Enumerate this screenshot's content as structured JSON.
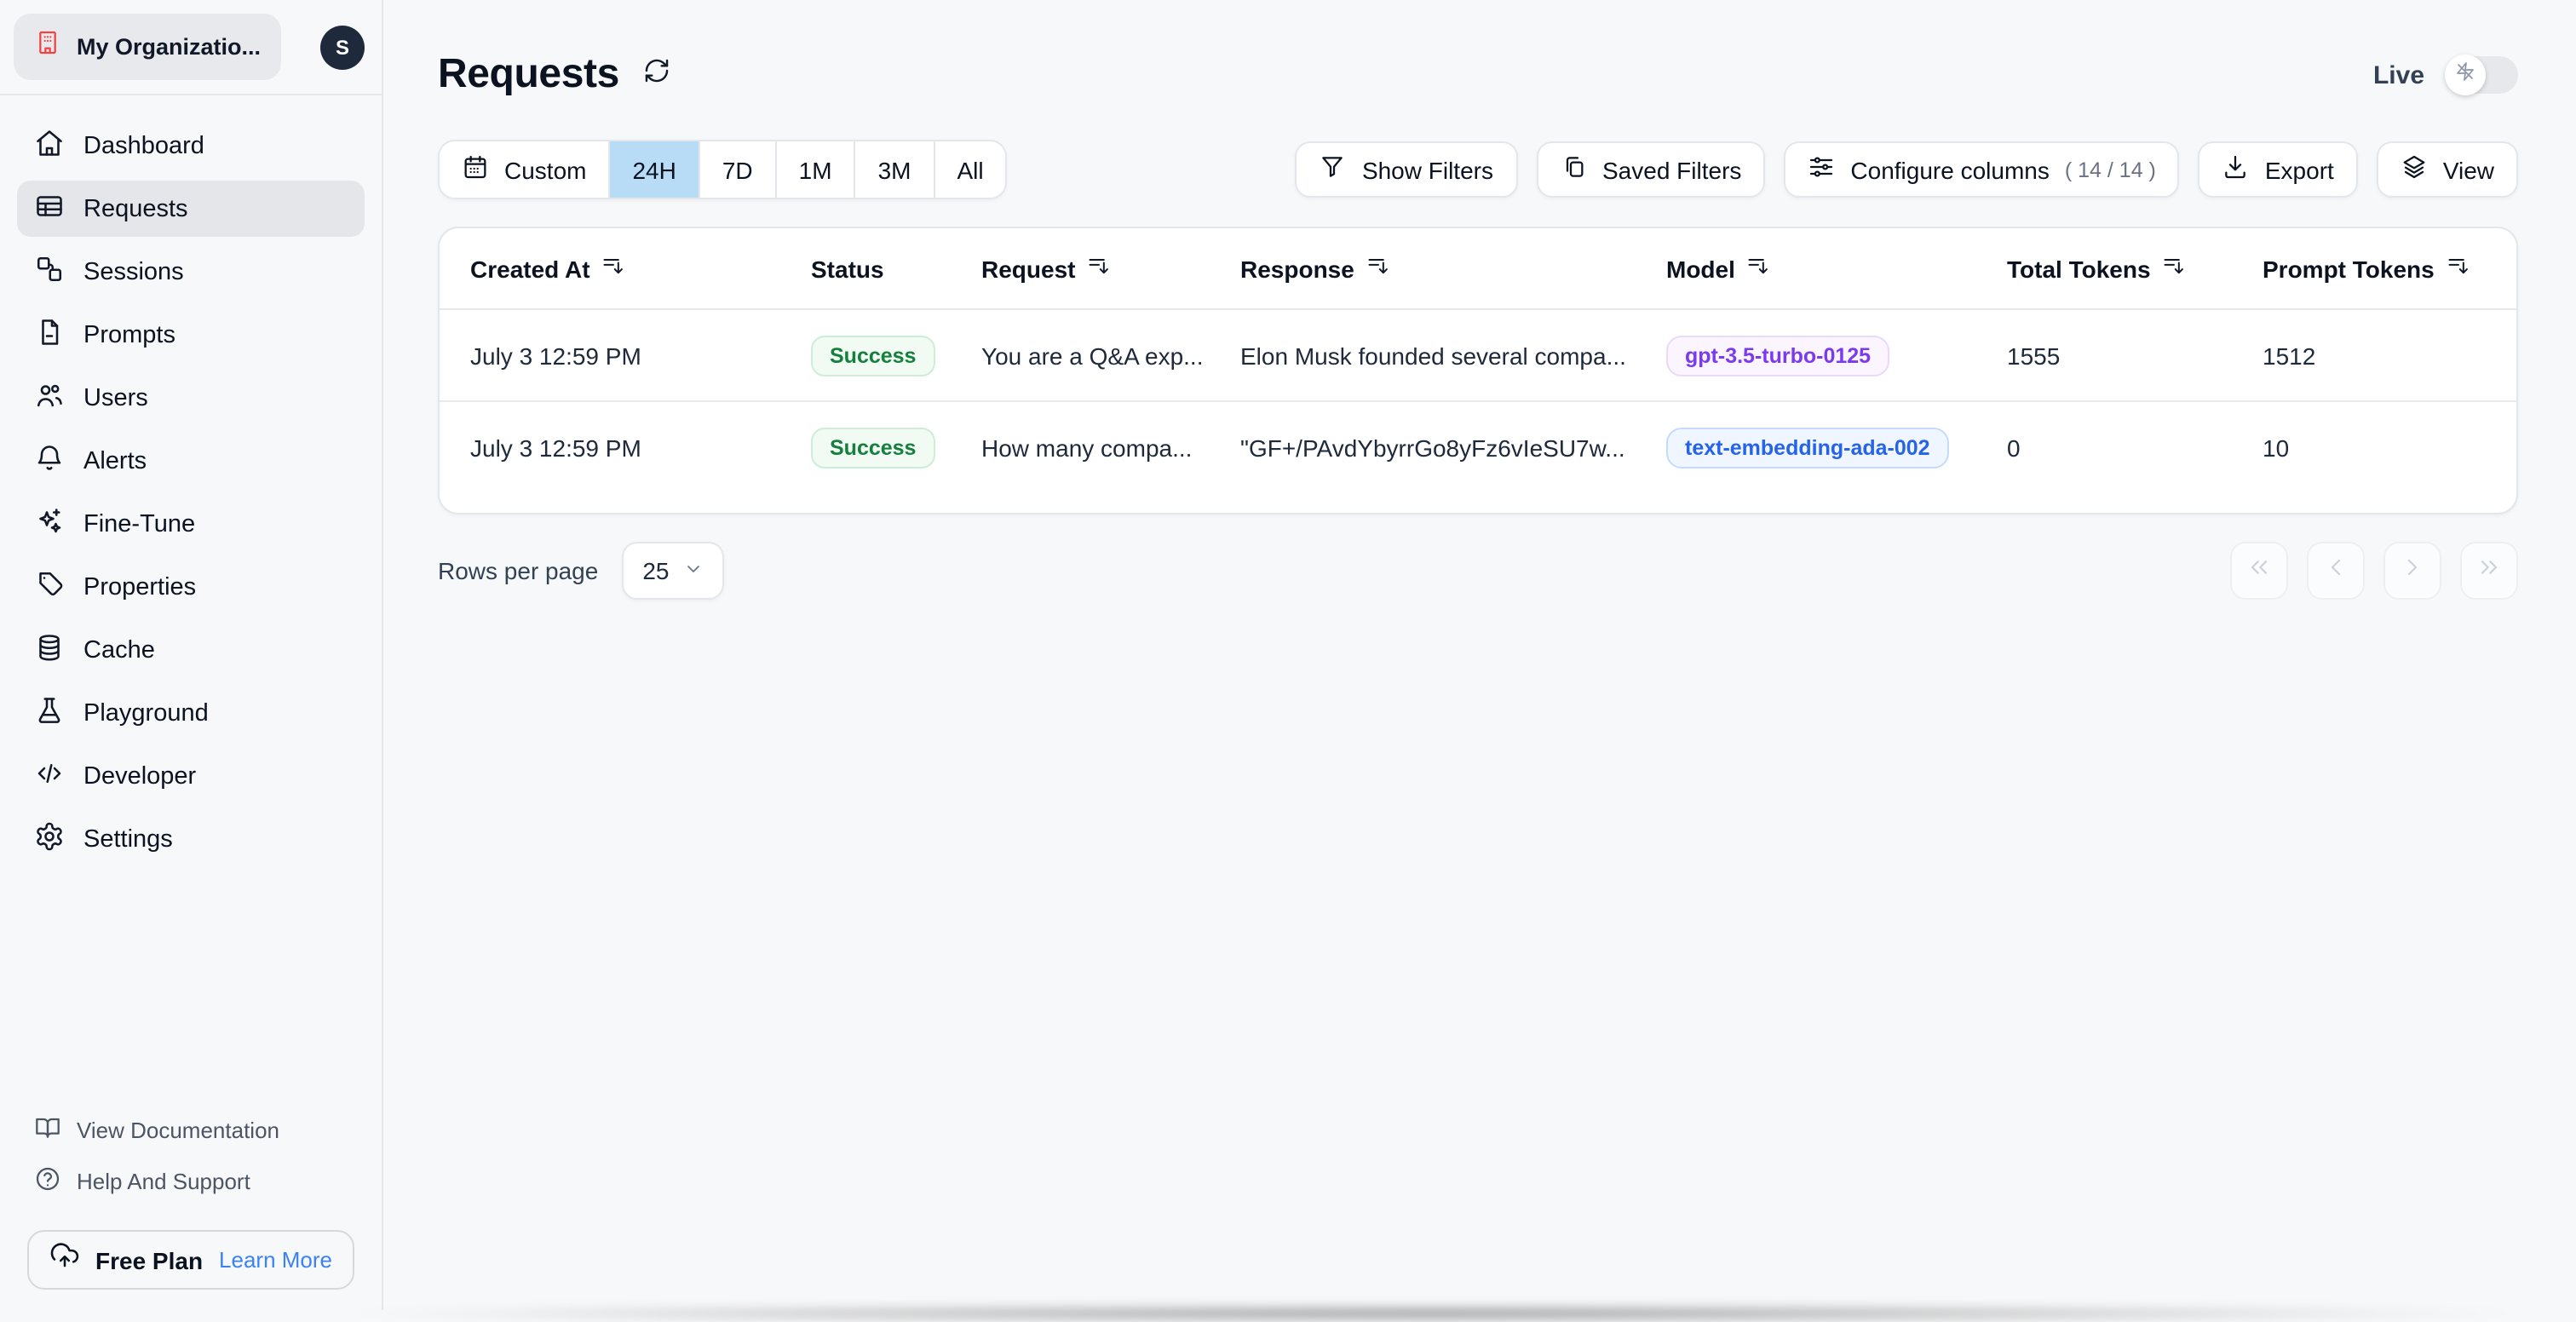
{
  "sidebar": {
    "org": {
      "name": "My Organizatio...",
      "avatar_initial": "S"
    },
    "nav": [
      {
        "label": "Dashboard",
        "icon": "home-icon",
        "active": false
      },
      {
        "label": "Requests",
        "icon": "table-icon",
        "active": true
      },
      {
        "label": "Sessions",
        "icon": "sessions-icon",
        "active": false
      },
      {
        "label": "Prompts",
        "icon": "document-icon",
        "active": false
      },
      {
        "label": "Users",
        "icon": "users-icon",
        "active": false
      },
      {
        "label": "Alerts",
        "icon": "bell-icon",
        "active": false
      },
      {
        "label": "Fine-Tune",
        "icon": "sparkles-icon",
        "active": false
      },
      {
        "label": "Properties",
        "icon": "tag-icon",
        "active": false
      },
      {
        "label": "Cache",
        "icon": "database-icon",
        "active": false
      },
      {
        "label": "Playground",
        "icon": "flask-icon",
        "active": false
      },
      {
        "label": "Developer",
        "icon": "code-icon",
        "active": false
      },
      {
        "label": "Settings",
        "icon": "gear-icon",
        "active": false
      }
    ],
    "footer_links": [
      {
        "label": "View Documentation",
        "icon": "book-open-icon"
      },
      {
        "label": "Help And Support",
        "icon": "help-circle-icon"
      }
    ],
    "plan": {
      "label": "Free Plan",
      "cta": "Learn More",
      "icon": "cloud-upload-icon"
    }
  },
  "header": {
    "title": "Requests",
    "live_label": "Live",
    "live_on": false
  },
  "toolbar": {
    "time_ranges": [
      {
        "label": "Custom",
        "icon": "calendar-icon",
        "selected": false
      },
      {
        "label": "24H",
        "selected": true
      },
      {
        "label": "7D",
        "selected": false
      },
      {
        "label": "1M",
        "selected": false
      },
      {
        "label": "3M",
        "selected": false
      },
      {
        "label": "All",
        "selected": false
      }
    ],
    "buttons": [
      {
        "label": "Show Filters",
        "icon": "funnel-icon"
      },
      {
        "label": "Saved Filters",
        "icon": "copy-icon"
      },
      {
        "label": "Configure columns",
        "suffix": "( 14 / 14 )",
        "icon": "sliders-icon"
      },
      {
        "label": "Export",
        "icon": "download-icon"
      },
      {
        "label": "View",
        "icon": "layers-icon"
      }
    ]
  },
  "table": {
    "columns": [
      {
        "label": "Created At",
        "sortable": true
      },
      {
        "label": "Status",
        "sortable": false
      },
      {
        "label": "Request",
        "sortable": true
      },
      {
        "label": "Response",
        "sortable": true
      },
      {
        "label": "Model",
        "sortable": true
      },
      {
        "label": "Total Tokens",
        "sortable": true
      },
      {
        "label": "Prompt Tokens",
        "sortable": true
      }
    ],
    "rows": [
      {
        "created_at": "July 3 12:59 PM",
        "status": "Success",
        "request": "You are a Q&A exp...",
        "response": "Elon Musk founded several compa...",
        "model": "gpt-3.5-turbo-0125",
        "model_color": "purple",
        "total_tokens": "1555",
        "prompt_tokens": "1512"
      },
      {
        "created_at": "July 3 12:59 PM",
        "status": "Success",
        "request": "How many compa...",
        "response": "\"GF+/PAvdYbyrrGo8yFz6vIeSU7w...",
        "model": "text-embedding-ada-002",
        "model_color": "blue",
        "total_tokens": "0",
        "prompt_tokens": "10"
      }
    ]
  },
  "pagination": {
    "rows_per_page_label": "Rows per page",
    "rows_per_page_value": "25"
  },
  "colors": {
    "page_bg": "#f7f8f9",
    "border": "#e5e7eb",
    "selected_range_bg": "#b9dcf6",
    "success_text": "#15803d",
    "success_bg": "#f1faf3",
    "model_purple": "#7c3aed",
    "model_blue": "#2563eb",
    "link_blue": "#3b82f6",
    "org_icon_red": "#ef4444",
    "avatar_bg": "#1e293b"
  }
}
